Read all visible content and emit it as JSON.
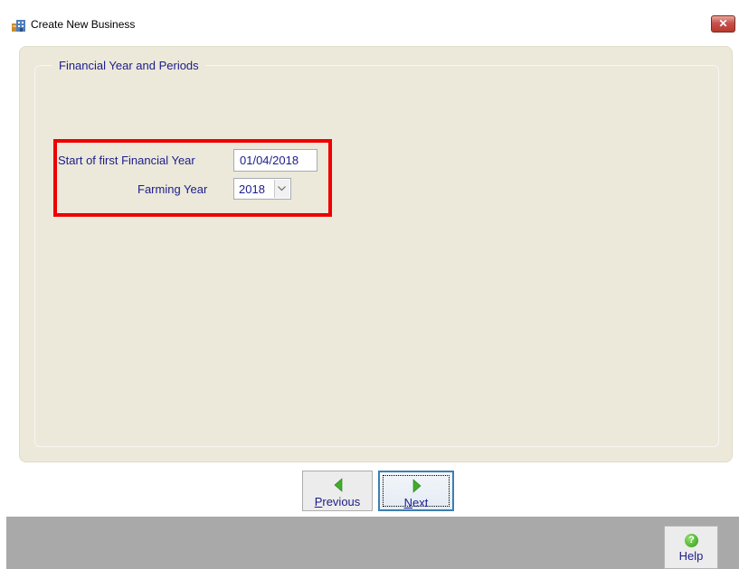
{
  "window": {
    "title": "Create New Business",
    "close_label": "✕",
    "icon": "business-app-icon"
  },
  "group": {
    "title": "Financial Year and Periods"
  },
  "fields": {
    "start_label": "Start of first Financial Year",
    "start_value": "01/04/2018",
    "farming_label": "Farming Year",
    "farming_value": "2018"
  },
  "nav": {
    "previous_hotkey": "P",
    "previous_rest": "revious",
    "next_hotkey": "N",
    "next_rest": "ext"
  },
  "footer": {
    "help_label": "Help",
    "help_icon_glyph": "?"
  },
  "colors": {
    "label": "#1c1c8c",
    "highlight": "#ee0000",
    "panel": "#ece9da",
    "footer": "#a9a9a9",
    "nav_arrow": "#3fae2a"
  }
}
